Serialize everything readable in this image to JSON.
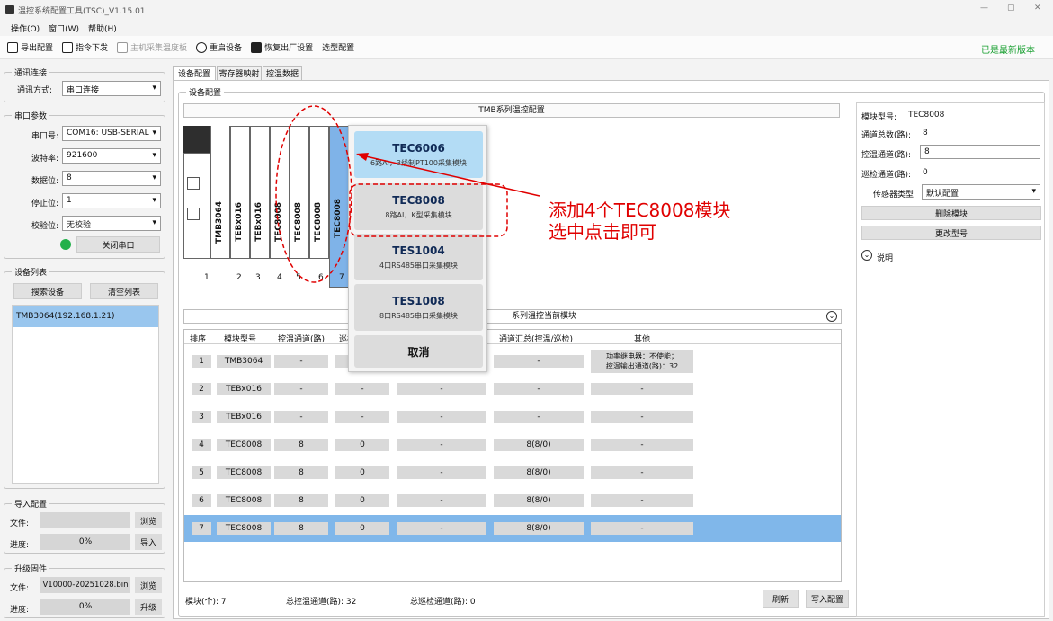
{
  "window": {
    "title": "温控系统配置工具(TSC)_V1.15.01",
    "minimize": "—",
    "restore": "▢",
    "close": "✕"
  },
  "menu": [
    "操作(O)",
    "窗口(W)",
    "帮助(H)"
  ],
  "toolbar": {
    "export": "导出配置",
    "command": "指令下发",
    "host_board": "主机采集温度板",
    "restart": "重启设备",
    "factory": "恢复出厂设置",
    "select_config": "选型配置",
    "latest": "已是最新版本"
  },
  "comm": {
    "title": "通讯连接",
    "mode_label": "通讯方式:",
    "mode_value": "串口连接"
  },
  "serial": {
    "title": "串口参数",
    "port_label": "串口号:",
    "port_value": "COM16: USB-SERIAL",
    "baud_label": "波特率:",
    "baud_value": "921600",
    "data_label": "数据位:",
    "data_value": "8",
    "stop_label": "停止位:",
    "stop_value": "1",
    "parity_label": "校验位:",
    "parity_value": "无校验",
    "close_btn": "关闭串口",
    "status_color": "#22b04a"
  },
  "devices": {
    "title": "设备列表",
    "search_btn": "搜索设备",
    "clear_btn": "清空列表",
    "item": "TMB3064(192.168.1.21)"
  },
  "import": {
    "title": "导入配置",
    "file_label": "文件:",
    "file_value": "",
    "browse": "浏览",
    "progress_label": "进度:",
    "progress_value": "0%",
    "import_btn": "导入"
  },
  "upgrade": {
    "title": "升级固件",
    "file_label": "文件:",
    "file_value": "V10000-20251028.bin",
    "browse": "浏览",
    "progress_label": "进度:",
    "progress_value": "0%",
    "upgrade_btn": "升级"
  },
  "tabs": [
    "设备配置",
    "寄存器映射",
    "控温数据"
  ],
  "config": {
    "title": "设备配置",
    "banner": "TMB系列温控配置",
    "current_label": "系列温控当前模块",
    "numbers": [
      "1",
      "2",
      "3",
      "4",
      "5",
      "6",
      "7"
    ],
    "modules": [
      "TMB3064",
      "TEBx016",
      "TEBx016",
      "TEC8008",
      "TEC8008",
      "TEC8008",
      "TEC8008"
    ]
  },
  "table": {
    "headers": [
      "排序",
      "模块型号",
      "控温通道(路)",
      "巡检",
      "",
      "通道汇总(控温/巡检)",
      "其他"
    ],
    "rows": [
      {
        "n": "1",
        "model": "TMB3064",
        "ctrl": "-",
        "insp": "-",
        "blank": "",
        "sum": "-",
        "other": "功率继电器：不使能；\n控温输出通道(路)：32"
      },
      {
        "n": "2",
        "model": "TEBx016",
        "ctrl": "-",
        "insp": "-",
        "blank": "-",
        "sum": "-",
        "other": "-"
      },
      {
        "n": "3",
        "model": "TEBx016",
        "ctrl": "-",
        "insp": "-",
        "blank": "-",
        "sum": "-",
        "other": "-"
      },
      {
        "n": "4",
        "model": "TEC8008",
        "ctrl": "8",
        "insp": "0",
        "blank": "-",
        "sum": "8(8/0)",
        "other": "-"
      },
      {
        "n": "5",
        "model": "TEC8008",
        "ctrl": "8",
        "insp": "0",
        "blank": "-",
        "sum": "8(8/0)",
        "other": "-"
      },
      {
        "n": "6",
        "model": "TEC8008",
        "ctrl": "8",
        "insp": "0",
        "blank": "-",
        "sum": "8(8/0)",
        "other": "-"
      },
      {
        "n": "7",
        "model": "TEC8008",
        "ctrl": "8",
        "insp": "0",
        "blank": "-",
        "sum": "8(8/0)",
        "other": "-"
      }
    ]
  },
  "footer": {
    "modules": "模块(个):  7",
    "ctrl_total": "总控温通道(路):  32",
    "insp_total": "总巡检通道(路):  0",
    "refresh": "刷新",
    "write": "写入配置"
  },
  "right": {
    "model_label": "模块型号:",
    "model_value": "TEC8008",
    "total_label": "通道总数(路):",
    "total_value": "8",
    "ctrl_label": "控温通道(路):",
    "ctrl_value": "8",
    "insp_label": "巡检通道(路):",
    "insp_value": "0",
    "sensor_label": "传感器类型:",
    "sensor_value": "默认配置",
    "delete_btn": "删除模块",
    "change_btn": "更改型号",
    "note": "说明"
  },
  "popup": [
    {
      "title": "TEC6006",
      "sub": "6路AI，3线制PT100采集模块"
    },
    {
      "title": "TEC8008",
      "sub": "8路AI，K型采集模块"
    },
    {
      "title": "TES1004",
      "sub": "4口RS485串口采集模块"
    },
    {
      "title": "TES1008",
      "sub": "8口RS485串口采集模块"
    }
  ],
  "popup_cancel": "取消",
  "annotation": {
    "line1": "添加4个TEC8008模块",
    "line2": "选中点击即可",
    "color": "#e00000"
  }
}
